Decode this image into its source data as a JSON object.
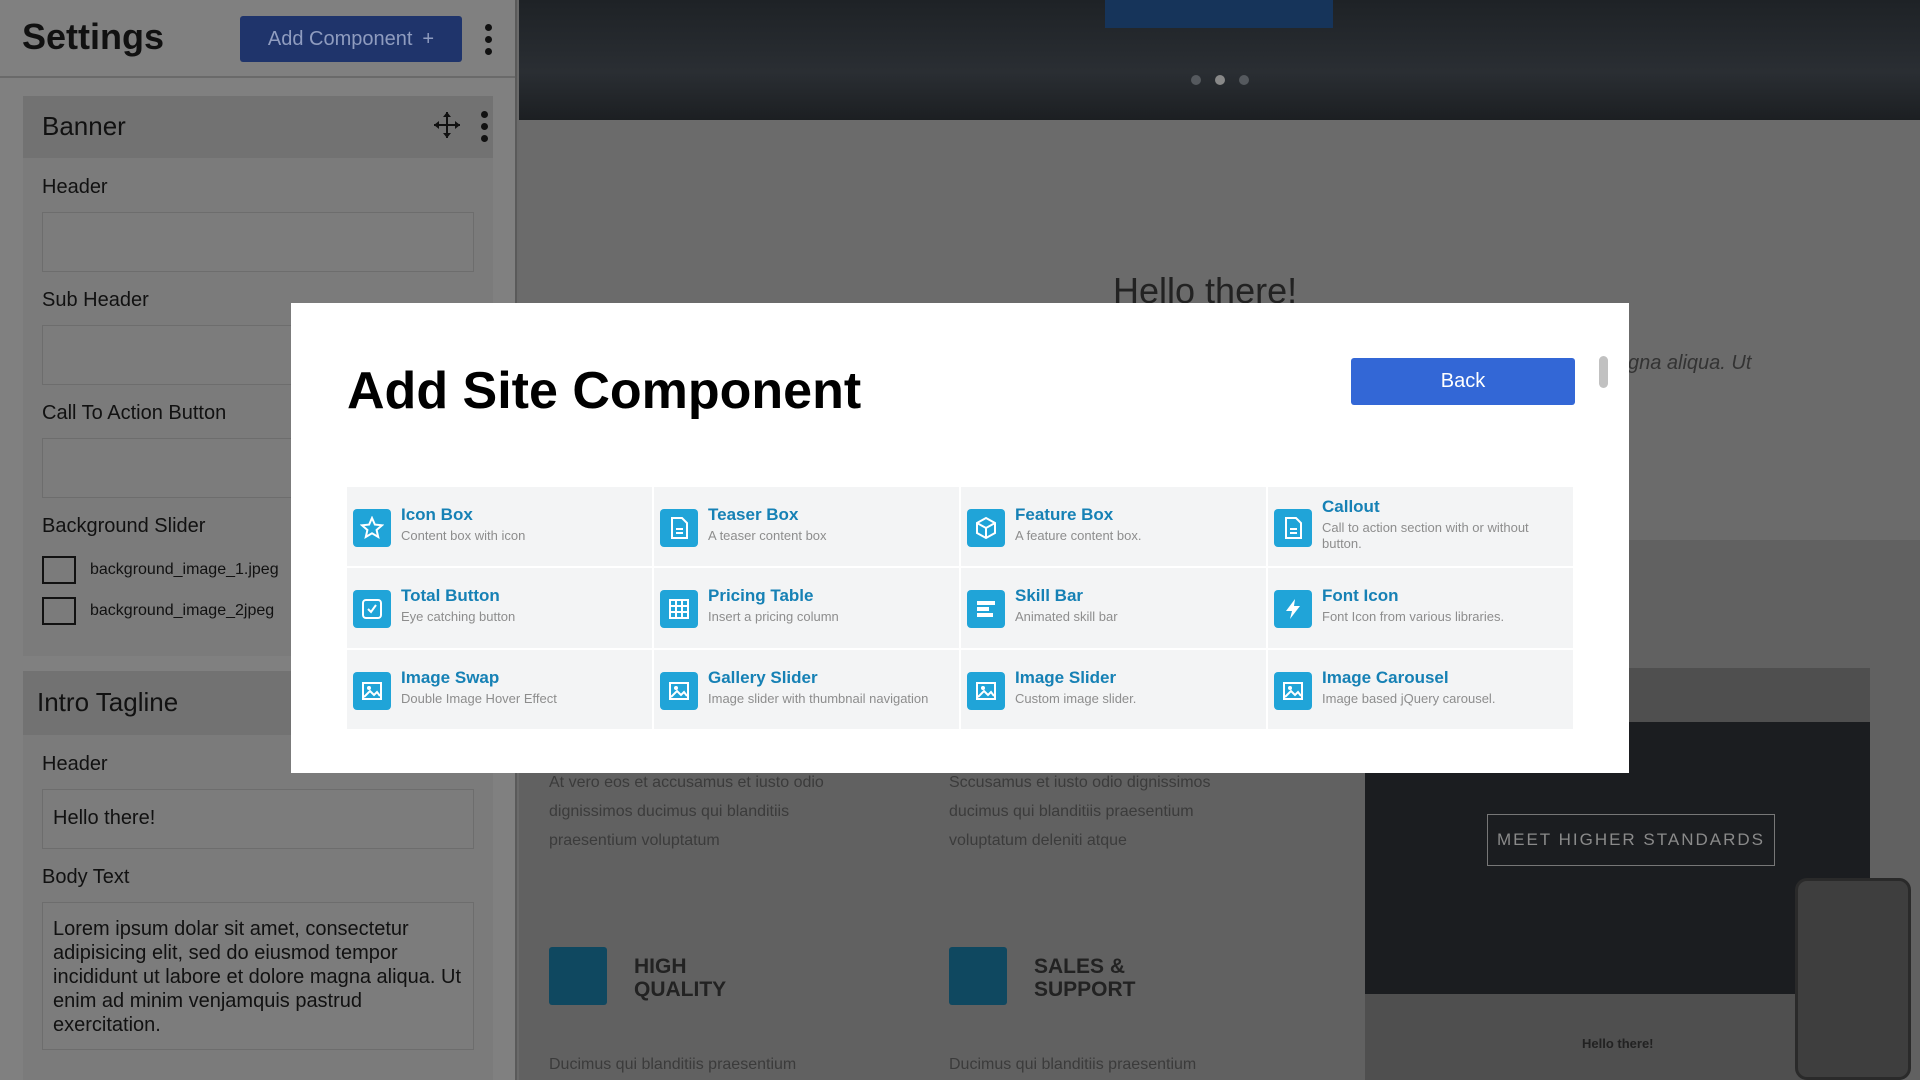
{
  "sidebar": {
    "title": "Settings",
    "add_component_label": "Add Component",
    "add_component_icon": "+",
    "sections": {
      "banner": {
        "title": "Banner",
        "header_label": "Header",
        "sub_header_label": "Sub Header",
        "cta_label": "Call To Action Button",
        "slider_label": "Background Slider",
        "files": [
          "background_image_1.jpeg",
          "background_image_2jpeg"
        ]
      },
      "intro": {
        "title": "Intro Tagline",
        "header_label": "Header",
        "header_value": "Hello there!",
        "body_label": "Body Text",
        "body_value": "Lorem ipsum dolar sit amet, consectetur adipisicing elit, sed do eiusmod tempor incididunt ut labore et dolore magna aliqua. Ut enim ad minim venjamquis pastrud exercitation."
      }
    }
  },
  "site": {
    "hello": "Hello there!",
    "lorem_fragment": "gna aliqua. Ut",
    "col1_text": "At vero eos et accusamus et iusto odio dignissimos ducimus qui blanditiis praesentium voluptatum",
    "col2_text": "Sccusamus et iusto odio dignissimos ducimus qui blanditiis praesentium voluptatum deleniti atque",
    "feature1_title": "HIGH QUALITY",
    "feature2_title": "SALES & SUPPORT",
    "feature_text": "Ducimus qui blanditiis praesentium",
    "mock_cta": "MEET HIGHER STANDARDS",
    "mock_hello": "Hello there!"
  },
  "modal": {
    "title": "Add Site Component",
    "back_label": "Back",
    "components": [
      {
        "name": "Icon Box",
        "desc": "Content box with icon",
        "icon": "star-icon"
      },
      {
        "name": "Teaser Box",
        "desc": "A teaser content box",
        "icon": "document-icon"
      },
      {
        "name": "Feature Box",
        "desc": "A feature content box.",
        "icon": "cube-icon"
      },
      {
        "name": "Callout",
        "desc": "Call to action section with or without button.",
        "icon": "document-icon"
      },
      {
        "name": "Total Button",
        "desc": "Eye catching button",
        "icon": "cursor-icon"
      },
      {
        "name": "Pricing Table",
        "desc": "Insert a pricing column",
        "icon": "table-icon"
      },
      {
        "name": "Skill Bar",
        "desc": "Animated skill bar",
        "icon": "bars-icon"
      },
      {
        "name": "Font Icon",
        "desc": "Font Icon from various libraries.",
        "icon": "bolt-icon"
      },
      {
        "name": "Image Swap",
        "desc": "Double Image Hover Effect",
        "icon": "image-icon"
      },
      {
        "name": "Gallery Slider",
        "desc": "Image slider with thumbnail navigation",
        "icon": "image-icon"
      },
      {
        "name": "Image Slider",
        "desc": "Custom image slider.",
        "icon": "image-icon"
      },
      {
        "name": "Image Carousel",
        "desc": "Image based jQuery carousel.",
        "icon": "image-icon"
      }
    ]
  },
  "colors": {
    "primary_button": "#3367d6",
    "component_icon": "#20a4d8",
    "component_name": "#1681b5"
  }
}
